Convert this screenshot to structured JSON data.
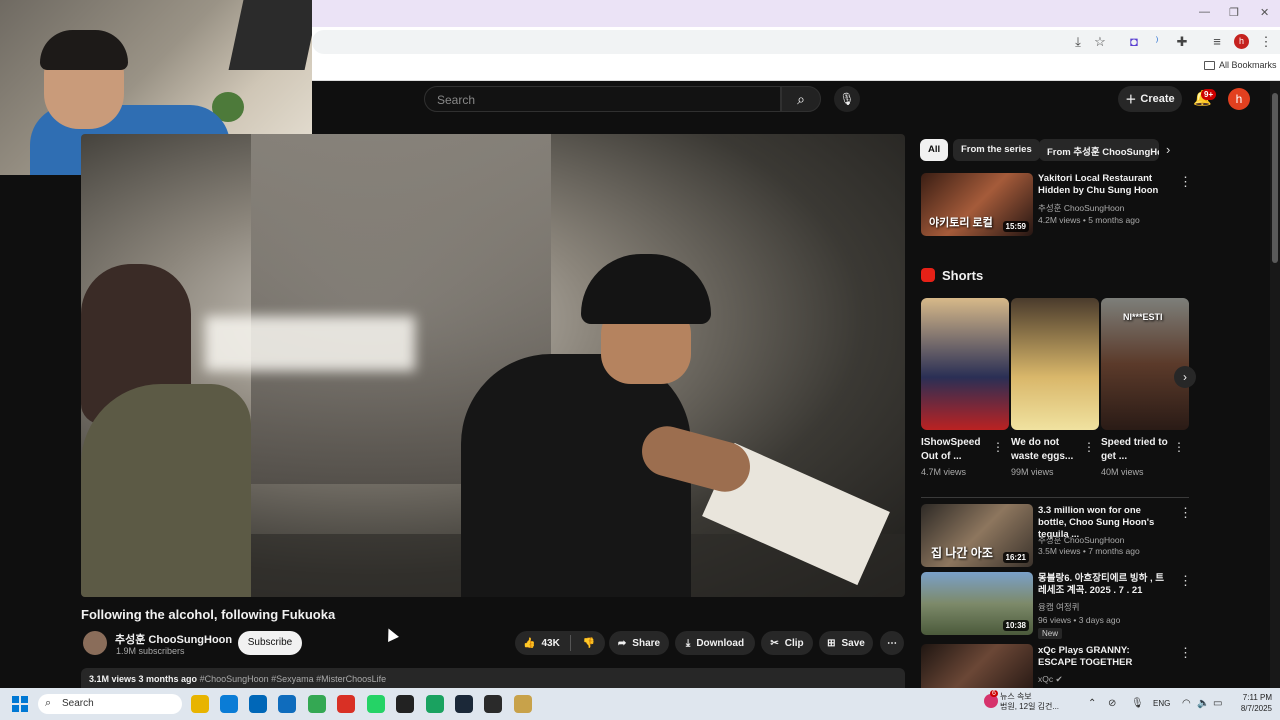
{
  "browser": {
    "window_controls": [
      "—",
      "❐",
      "✕"
    ],
    "all_bookmarks_label": "All Bookmarks",
    "profile_initial": "h"
  },
  "header": {
    "search_placeholder": "Search",
    "create_label": "Create",
    "notification_badge": "9+",
    "avatar_initial": "h"
  },
  "video": {
    "title": "Following the alcohol, following Fukuoka",
    "channel_name": "추성훈 ChooSungHoon",
    "subscribers": "1.9M subscribers",
    "subscribe_label": "Subscribe",
    "like_count": "43K",
    "share_label": "Share",
    "download_label": "Download",
    "clip_label": "Clip",
    "save_label": "Save",
    "views": "3.1M views",
    "age": "3 months ago",
    "hashtags": "#ChooSungHoon #Sexyama #MisterChoosLife"
  },
  "sidebar": {
    "chips": [
      "All",
      "From the series",
      "From 추성훈 ChooSungHoon"
    ],
    "shorts_label": "Shorts",
    "videos": [
      {
        "title": "Yakitori Local Restaurant Hidden by Chu Sung Hoon",
        "channel": "추성훈 ChooSungHoon",
        "meta": "4.2M views • 5 months ago",
        "duration": "15:59",
        "thumb_caption": "야키토리 로컬"
      },
      {
        "title": "3.3 million won for one bottle, Choo Sung Hoon's tequila ...",
        "channel": "추성훈 ChooSungHoon",
        "meta": "3.5M views • 7 months ago",
        "duration": "16:21",
        "thumb_caption": "집 나간 아조"
      },
      {
        "title": "몽블랑6. 아흐장티에르 빙하 , 트레세조 계곡. 2025 . 7 . 21",
        "channel": "융캠 여정퀴",
        "meta": "96 views • 3 days ago",
        "duration": "10:38",
        "badge": "New"
      },
      {
        "title": "xQc Plays GRANNY: ESCAPE TOGETHER",
        "channel": "xQc ✔"
      }
    ],
    "shorts": [
      {
        "title": "IShowSpeed Out of ...",
        "views": "4.7M views"
      },
      {
        "title": "We do not waste eggs...",
        "views": "99M views"
      },
      {
        "title": "Speed tried to get ...",
        "views": "40M views",
        "overlay": "NI***ESTI"
      }
    ]
  },
  "taskbar": {
    "search_label": "Search",
    "news_line1": "뉴스 속보",
    "news_line2": "법원, 12일 김건...",
    "lang": "ENG",
    "time": "7:11 PM",
    "date": "8/7/2025",
    "news_badge": "6",
    "app_colors": [
      "#e8b400",
      "#0a7cd6",
      "#0067b8",
      "#0f6cbd",
      "#34a853",
      "#d93025",
      "#25d366",
      "#222222",
      "#1aa260",
      "#1b2838",
      "#2a2a2a",
      "#c8a24a"
    ]
  },
  "icons": {
    "search": "search-icon",
    "mic": "mic-icon",
    "bell": "bell-icon",
    "like": "thumbs-up-icon",
    "dislike": "thumbs-down-icon",
    "share": "share-icon",
    "download": "download-icon",
    "clip": "scissors-icon",
    "save": "bookmark-icon",
    "more": "more-horizontal-icon"
  }
}
